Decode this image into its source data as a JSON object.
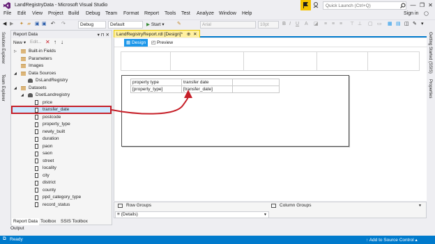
{
  "window": {
    "title": "LandRegistryData - Microsoft Visual Studio",
    "quick_launch_placeholder": "Quick Launch (Ctrl+Q)",
    "sign_in": "Sign in",
    "controls": [
      "—",
      "❐",
      "✕"
    ]
  },
  "menu": [
    "File",
    "Edit",
    "View",
    "Project",
    "Build",
    "Debug",
    "Team",
    "Format",
    "Report",
    "Tools",
    "Test",
    "Analyze",
    "Window",
    "Help"
  ],
  "toolbar": {
    "config": "Debug",
    "platform": "Default",
    "start": "Start",
    "font": "Arial",
    "size": "10pt"
  },
  "left_sidetabs": [
    "Solution Explorer",
    "Team Explorer"
  ],
  "right_sidetabs": [
    "Getting Started (SSIS)",
    "Properties"
  ],
  "report_data": {
    "title": "Report Data",
    "header_glyphs": "▾ ⊓ ✕",
    "new_label": "New",
    "edit_label": "Edit...",
    "tree": [
      {
        "label": "Built-in Fields",
        "icon": "folder-icon",
        "depth": 0,
        "arrow": "▷"
      },
      {
        "label": "Parameters",
        "icon": "folder-icon",
        "depth": 0,
        "arrow": ""
      },
      {
        "label": "Images",
        "icon": "folder-icon",
        "depth": 0,
        "arrow": ""
      },
      {
        "label": "Data Sources",
        "icon": "folder-icon",
        "depth": 0,
        "arrow": "◢"
      },
      {
        "label": "DsLandRegistry",
        "icon": "database-icon",
        "depth": 1,
        "arrow": ""
      },
      {
        "label": "Datasets",
        "icon": "folder-icon",
        "depth": 0,
        "arrow": "◢"
      },
      {
        "label": "DsetLandregistry",
        "icon": "dataset-icon",
        "depth": 1,
        "arrow": "◢"
      },
      {
        "label": "price",
        "icon": "field-icon",
        "depth": 2,
        "arrow": ""
      },
      {
        "label": "transfer_date",
        "icon": "field-icon",
        "depth": 2,
        "arrow": ""
      },
      {
        "label": "postcode",
        "icon": "field-icon",
        "depth": 2,
        "arrow": ""
      },
      {
        "label": "property_type",
        "icon": "field-icon",
        "depth": 2,
        "arrow": ""
      },
      {
        "label": "newly_built",
        "icon": "field-icon",
        "depth": 2,
        "arrow": ""
      },
      {
        "label": "duration",
        "icon": "field-icon",
        "depth": 2,
        "arrow": ""
      },
      {
        "label": "paon",
        "icon": "field-icon",
        "depth": 2,
        "arrow": ""
      },
      {
        "label": "saon",
        "icon": "field-icon",
        "depth": 2,
        "arrow": ""
      },
      {
        "label": "street",
        "icon": "field-icon",
        "depth": 2,
        "arrow": ""
      },
      {
        "label": "locality",
        "icon": "field-icon",
        "depth": 2,
        "arrow": ""
      },
      {
        "label": "city",
        "icon": "field-icon",
        "depth": 2,
        "arrow": ""
      },
      {
        "label": "district",
        "icon": "field-icon",
        "depth": 2,
        "arrow": ""
      },
      {
        "label": "county",
        "icon": "field-icon",
        "depth": 2,
        "arrow": ""
      },
      {
        "label": "ppd_category_type",
        "icon": "field-icon",
        "depth": 2,
        "arrow": ""
      },
      {
        "label": "record_status",
        "icon": "field-icon",
        "depth": 2,
        "arrow": ""
      }
    ],
    "tabs": [
      "Report Data",
      "Toolbox",
      "SSIS Toolbox"
    ]
  },
  "output_tab": "Output",
  "document_tab": {
    "label": "LandRegistryReport.rdl [Design]*",
    "pin": "⊕",
    "close": "✕"
  },
  "designer": {
    "tabs": [
      "Design",
      "Preview"
    ],
    "table": {
      "headers": [
        "property type",
        "transfer date"
      ],
      "details": [
        "[property_type]",
        "[transfer_date]"
      ]
    }
  },
  "groups": {
    "row_label": "Row Groups",
    "column_label": "Column Groups",
    "row_value": "≡ (Details)"
  },
  "status": {
    "left": "Ready",
    "right": "Add to Source Control"
  },
  "colors": {
    "accent": "#007acc",
    "annotation": "#c61f28",
    "selection": "#cce8ff",
    "doc_tab": "#fff0a0"
  }
}
